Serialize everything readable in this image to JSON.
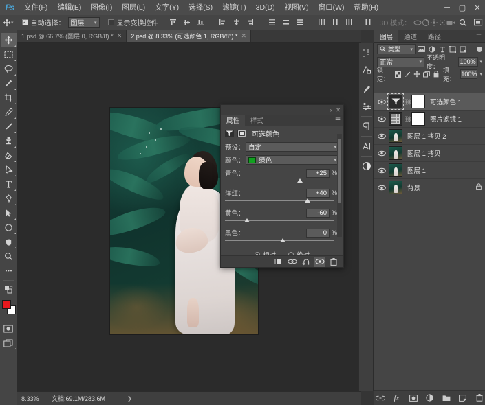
{
  "app": {
    "logo": "Ps"
  },
  "menubar": {
    "items": [
      {
        "label": "文件(F)"
      },
      {
        "label": "编辑(E)"
      },
      {
        "label": "图像(I)"
      },
      {
        "label": "图层(L)"
      },
      {
        "label": "文字(Y)"
      },
      {
        "label": "选择(S)"
      },
      {
        "label": "滤镜(T)"
      },
      {
        "label": "3D(D)"
      },
      {
        "label": "视图(V)"
      },
      {
        "label": "窗口(W)"
      },
      {
        "label": "帮助(H)"
      }
    ],
    "window_controls": {
      "minimize": "─",
      "maximize": "▢",
      "close": "✕"
    }
  },
  "options_bar": {
    "tool_icon": "move-tool-icon",
    "auto_select_label": "自动选择：",
    "auto_select_checked": true,
    "auto_select_value": "图层",
    "show_transform_label": "显示变换控件",
    "show_transform_checked": false,
    "three_d_mode_label": "3D 模式：",
    "search_icon": "search-icon",
    "arrange_icon": "arrange-documents-icon"
  },
  "tabs": [
    {
      "label": "1.psd @ 66.7% (图层 0, RGB/8) *",
      "active": false,
      "close": "✕"
    },
    {
      "label": "2.psd @ 8.33% (可选颜色 1, RGB/8*) *",
      "active": true,
      "close": "✕"
    }
  ],
  "toolbar": {
    "tools": [
      {
        "name": "move-tool",
        "active": true
      },
      {
        "name": "rectangular-marquee-tool",
        "active": false
      },
      {
        "name": "lasso-tool",
        "active": false
      },
      {
        "name": "magic-wand-tool",
        "active": false
      },
      {
        "name": "crop-tool",
        "active": false
      },
      {
        "name": "eyedropper-tool",
        "active": false
      },
      {
        "name": "healing-brush-tool",
        "active": false
      },
      {
        "name": "brush-tool",
        "active": false
      },
      {
        "name": "clone-stamp-tool",
        "active": false
      },
      {
        "name": "eraser-tool",
        "active": false
      },
      {
        "name": "gradient-tool",
        "active": false
      },
      {
        "name": "blur-tool",
        "active": false
      },
      {
        "name": "type-tool",
        "active": false
      },
      {
        "name": "pen-tool",
        "active": false
      },
      {
        "name": "path-selection-tool",
        "active": false
      },
      {
        "name": "ellipse-shape-tool",
        "active": false
      },
      {
        "name": "hand-tool",
        "active": false
      },
      {
        "name": "zoom-tool",
        "active": false
      },
      {
        "name": "more-tools",
        "active": false
      }
    ],
    "foreground_color": "#e8191e",
    "background_color": "#ffffff",
    "quick_mask": "quick-mask-icon",
    "screen_mode": "screen-mode-icon"
  },
  "properties_panel": {
    "collapse_icon": "«",
    "close_icon": "✕",
    "tabs": [
      {
        "label": "属性",
        "active": true
      },
      {
        "label": "样式",
        "active": false
      }
    ],
    "menu_icon": "panel-menu-icon",
    "title": "可选颜色",
    "preset_label": "预设：",
    "preset_value": "自定",
    "color_label": "颜色：",
    "color_value": "绿色",
    "color_swatch": "#12a020",
    "sliders": [
      {
        "label": "青色：",
        "value": "+25",
        "unit": "%",
        "pos": 65
      },
      {
        "label": "洋红：",
        "value": "+40",
        "unit": "%",
        "pos": 72
      },
      {
        "label": "黄色：",
        "value": "-60",
        "unit": "%",
        "pos": 19
      },
      {
        "label": "黑色：",
        "value": "0",
        "unit": "%",
        "pos": 50
      }
    ],
    "radio_relative": "相对",
    "radio_absolute": "绝对",
    "radio_selected": "相对",
    "footer_buttons": [
      {
        "name": "clip-to-layer-icon",
        "active": false
      },
      {
        "name": "view-previous-state-icon",
        "active": false
      },
      {
        "name": "reset-icon",
        "active": false
      },
      {
        "name": "toggle-visibility-icon",
        "active": true
      },
      {
        "name": "delete-adjustment-icon",
        "active": false
      }
    ]
  },
  "rail": {
    "buttons": [
      {
        "name": "history-icon"
      },
      {
        "name": "actions-icon"
      },
      {
        "name": "brush-settings-icon"
      },
      {
        "name": "adjustments-icon"
      },
      {
        "name": "paragraph-icon"
      },
      {
        "name": "character-icon"
      },
      {
        "name": "adjustment-layer-icon"
      }
    ]
  },
  "layers_panel": {
    "tabs": [
      {
        "label": "图层",
        "active": true
      },
      {
        "label": "通道",
        "active": false
      },
      {
        "label": "路径",
        "active": false
      }
    ],
    "menu_icon": "panel-menu-icon",
    "filter_label": "类型",
    "filter_search_icon": "search-icon",
    "filter_icons": [
      "pixel-filter-icon",
      "adjustment-filter-icon",
      "type-filter-icon",
      "shape-filter-icon",
      "smart-object-filter-icon"
    ],
    "filter_toggle": "filter-toggle-icon",
    "blend_mode": "正常",
    "opacity_label": "不透明度：",
    "opacity_value": "100%",
    "lock_label": "锁定：",
    "lock_icons": [
      "lock-transparency-icon",
      "lock-image-icon",
      "lock-position-icon",
      "lock-nesting-icon",
      "lock-all-icon"
    ],
    "fill_label": "填充：",
    "fill_value": "100%",
    "layers": [
      {
        "name": "可选颜色 1",
        "visible": true,
        "selected": true,
        "thumb": "selective-color",
        "has_mask": true,
        "linked": true,
        "locked": false
      },
      {
        "name": "照片滤镜 1",
        "visible": true,
        "selected": false,
        "thumb": "photo-filter",
        "has_mask": true,
        "linked": true,
        "locked": false
      },
      {
        "name": "图层 1 拷贝 2",
        "visible": true,
        "selected": false,
        "thumb": "photo",
        "has_mask": false,
        "linked": false,
        "locked": false
      },
      {
        "name": "图层 1 拷贝",
        "visible": true,
        "selected": false,
        "thumb": "photo",
        "has_mask": false,
        "linked": false,
        "locked": false
      },
      {
        "name": "图层 1",
        "visible": true,
        "selected": false,
        "thumb": "photo",
        "has_mask": false,
        "linked": false,
        "locked": false
      },
      {
        "name": "背景",
        "visible": true,
        "selected": false,
        "thumb": "photo",
        "has_mask": false,
        "linked": false,
        "locked": true
      }
    ],
    "footer_buttons": [
      {
        "name": "link-layers-icon"
      },
      {
        "name": "layer-style-fx-icon"
      },
      {
        "name": "add-layer-mask-icon"
      },
      {
        "name": "new-adjustment-layer-icon"
      },
      {
        "name": "new-group-icon"
      },
      {
        "name": "new-layer-icon"
      },
      {
        "name": "delete-layer-icon"
      }
    ]
  },
  "status_bar": {
    "zoom": "8.33%",
    "doc_label": "文档:69.1M/283.6M",
    "arrow": "❯"
  }
}
